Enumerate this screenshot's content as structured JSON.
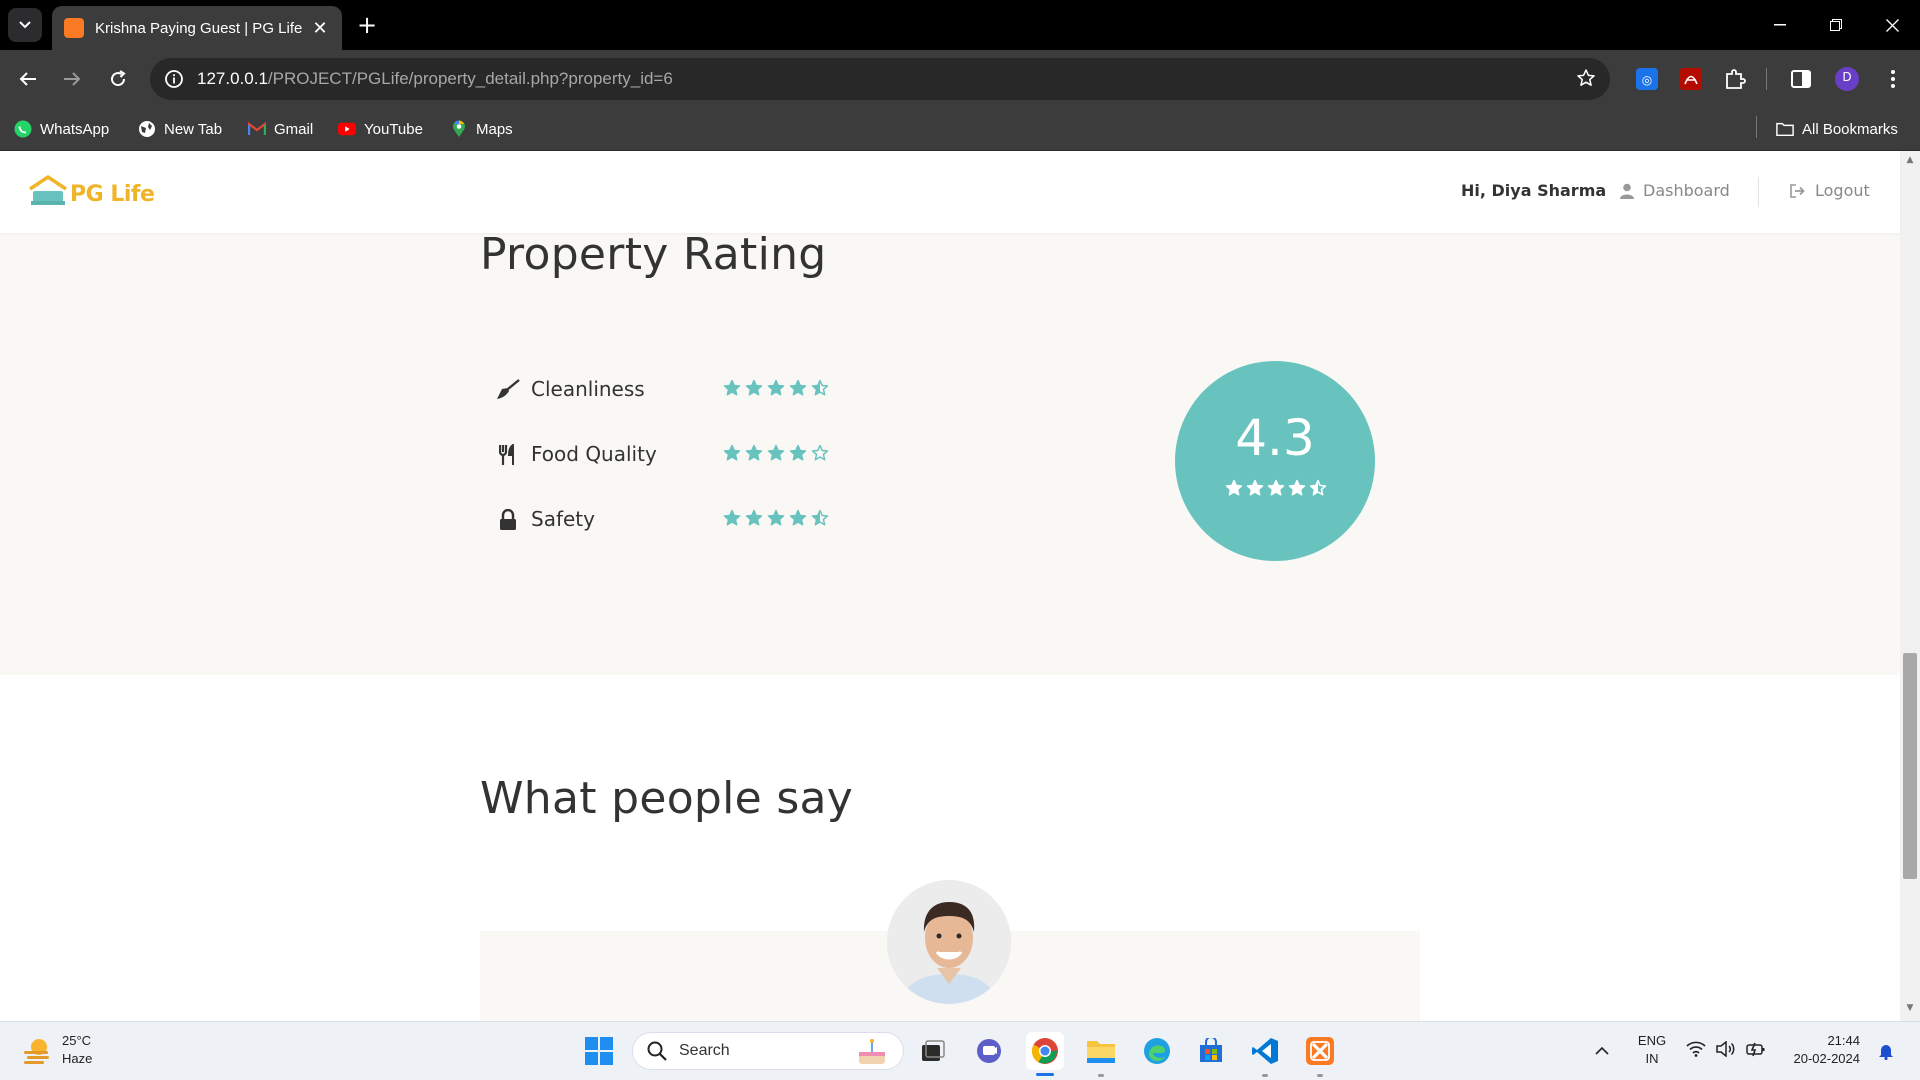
{
  "browser": {
    "tab_title": "Krishna Paying Guest | PG Life",
    "url_host": "127.0.0.1",
    "url_path": "/PROJECT/PGLife/property_detail.php?property_id=6",
    "profile_initial": "D",
    "bookmarks": [
      "WhatsApp",
      "New Tab",
      "Gmail",
      "YouTube",
      "Maps"
    ],
    "all_bookmarks": "All Bookmarks"
  },
  "site": {
    "logo_text": "PG Life",
    "greeting": "Hi, Diya Sharma",
    "dashboard_label": "Dashboard",
    "logout_label": "Logout"
  },
  "rating_section": {
    "title": "Property Rating",
    "items": [
      {
        "label": "Cleanliness",
        "icon": "broom-icon",
        "stars": 4.5
      },
      {
        "label": "Food Quality",
        "icon": "utensils-icon",
        "stars": 4
      },
      {
        "label": "Safety",
        "icon": "lock-icon",
        "stars": 4.5
      }
    ],
    "overall": "4.3",
    "overall_stars": 4.5,
    "accent_color": "#68c3bf"
  },
  "testimonials": {
    "title": "What people say"
  },
  "taskbar": {
    "weather_temp": "25°C",
    "weather_desc": "Haze",
    "search_placeholder": "Search",
    "lang_line1": "ENG",
    "lang_line2": "IN",
    "time": "21:44",
    "date": "20-02-2024"
  }
}
